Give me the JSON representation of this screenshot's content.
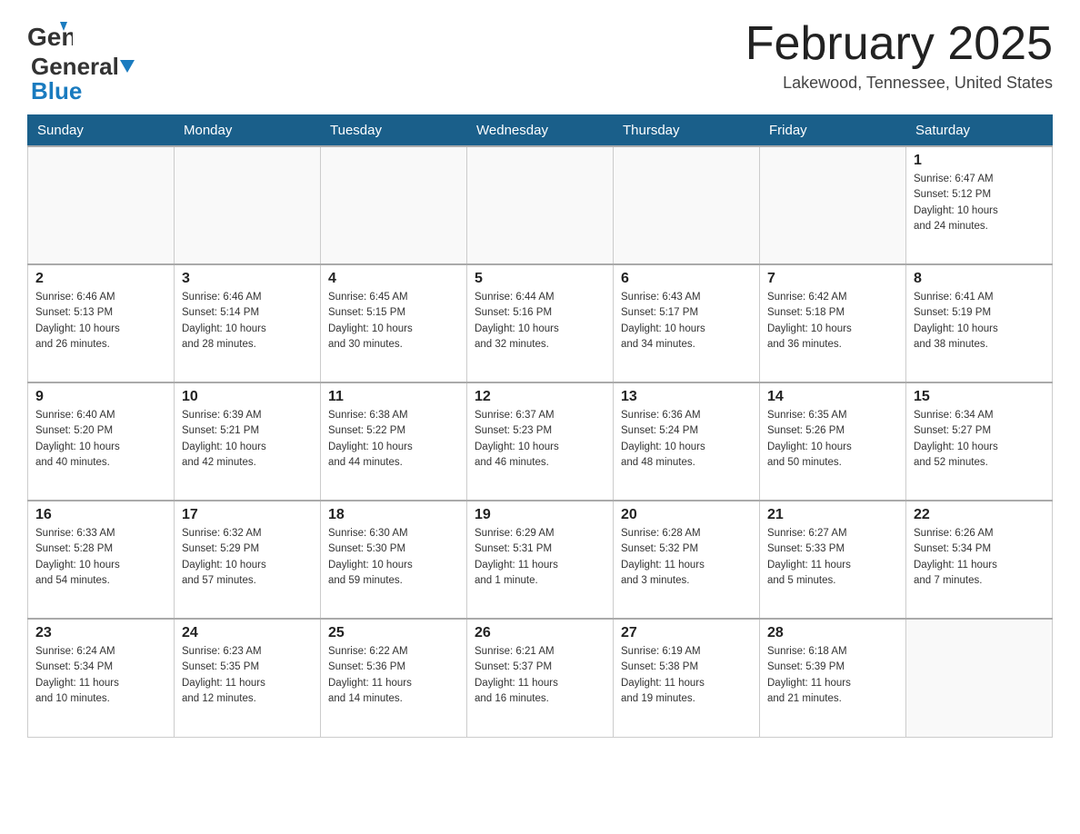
{
  "header": {
    "logo_general": "General",
    "logo_blue": "Blue",
    "title": "February 2025",
    "location": "Lakewood, Tennessee, United States"
  },
  "weekdays": [
    "Sunday",
    "Monday",
    "Tuesday",
    "Wednesday",
    "Thursday",
    "Friday",
    "Saturday"
  ],
  "weeks": [
    [
      {
        "day": "",
        "info": ""
      },
      {
        "day": "",
        "info": ""
      },
      {
        "day": "",
        "info": ""
      },
      {
        "day": "",
        "info": ""
      },
      {
        "day": "",
        "info": ""
      },
      {
        "day": "",
        "info": ""
      },
      {
        "day": "1",
        "info": "Sunrise: 6:47 AM\nSunset: 5:12 PM\nDaylight: 10 hours\nand 24 minutes."
      }
    ],
    [
      {
        "day": "2",
        "info": "Sunrise: 6:46 AM\nSunset: 5:13 PM\nDaylight: 10 hours\nand 26 minutes."
      },
      {
        "day": "3",
        "info": "Sunrise: 6:46 AM\nSunset: 5:14 PM\nDaylight: 10 hours\nand 28 minutes."
      },
      {
        "day": "4",
        "info": "Sunrise: 6:45 AM\nSunset: 5:15 PM\nDaylight: 10 hours\nand 30 minutes."
      },
      {
        "day": "5",
        "info": "Sunrise: 6:44 AM\nSunset: 5:16 PM\nDaylight: 10 hours\nand 32 minutes."
      },
      {
        "day": "6",
        "info": "Sunrise: 6:43 AM\nSunset: 5:17 PM\nDaylight: 10 hours\nand 34 minutes."
      },
      {
        "day": "7",
        "info": "Sunrise: 6:42 AM\nSunset: 5:18 PM\nDaylight: 10 hours\nand 36 minutes."
      },
      {
        "day": "8",
        "info": "Sunrise: 6:41 AM\nSunset: 5:19 PM\nDaylight: 10 hours\nand 38 minutes."
      }
    ],
    [
      {
        "day": "9",
        "info": "Sunrise: 6:40 AM\nSunset: 5:20 PM\nDaylight: 10 hours\nand 40 minutes."
      },
      {
        "day": "10",
        "info": "Sunrise: 6:39 AM\nSunset: 5:21 PM\nDaylight: 10 hours\nand 42 minutes."
      },
      {
        "day": "11",
        "info": "Sunrise: 6:38 AM\nSunset: 5:22 PM\nDaylight: 10 hours\nand 44 minutes."
      },
      {
        "day": "12",
        "info": "Sunrise: 6:37 AM\nSunset: 5:23 PM\nDaylight: 10 hours\nand 46 minutes."
      },
      {
        "day": "13",
        "info": "Sunrise: 6:36 AM\nSunset: 5:24 PM\nDaylight: 10 hours\nand 48 minutes."
      },
      {
        "day": "14",
        "info": "Sunrise: 6:35 AM\nSunset: 5:26 PM\nDaylight: 10 hours\nand 50 minutes."
      },
      {
        "day": "15",
        "info": "Sunrise: 6:34 AM\nSunset: 5:27 PM\nDaylight: 10 hours\nand 52 minutes."
      }
    ],
    [
      {
        "day": "16",
        "info": "Sunrise: 6:33 AM\nSunset: 5:28 PM\nDaylight: 10 hours\nand 54 minutes."
      },
      {
        "day": "17",
        "info": "Sunrise: 6:32 AM\nSunset: 5:29 PM\nDaylight: 10 hours\nand 57 minutes."
      },
      {
        "day": "18",
        "info": "Sunrise: 6:30 AM\nSunset: 5:30 PM\nDaylight: 10 hours\nand 59 minutes."
      },
      {
        "day": "19",
        "info": "Sunrise: 6:29 AM\nSunset: 5:31 PM\nDaylight: 11 hours\nand 1 minute."
      },
      {
        "day": "20",
        "info": "Sunrise: 6:28 AM\nSunset: 5:32 PM\nDaylight: 11 hours\nand 3 minutes."
      },
      {
        "day": "21",
        "info": "Sunrise: 6:27 AM\nSunset: 5:33 PM\nDaylight: 11 hours\nand 5 minutes."
      },
      {
        "day": "22",
        "info": "Sunrise: 6:26 AM\nSunset: 5:34 PM\nDaylight: 11 hours\nand 7 minutes."
      }
    ],
    [
      {
        "day": "23",
        "info": "Sunrise: 6:24 AM\nSunset: 5:34 PM\nDaylight: 11 hours\nand 10 minutes."
      },
      {
        "day": "24",
        "info": "Sunrise: 6:23 AM\nSunset: 5:35 PM\nDaylight: 11 hours\nand 12 minutes."
      },
      {
        "day": "25",
        "info": "Sunrise: 6:22 AM\nSunset: 5:36 PM\nDaylight: 11 hours\nand 14 minutes."
      },
      {
        "day": "26",
        "info": "Sunrise: 6:21 AM\nSunset: 5:37 PM\nDaylight: 11 hours\nand 16 minutes."
      },
      {
        "day": "27",
        "info": "Sunrise: 6:19 AM\nSunset: 5:38 PM\nDaylight: 11 hours\nand 19 minutes."
      },
      {
        "day": "28",
        "info": "Sunrise: 6:18 AM\nSunset: 5:39 PM\nDaylight: 11 hours\nand 21 minutes."
      },
      {
        "day": "",
        "info": ""
      }
    ]
  ]
}
